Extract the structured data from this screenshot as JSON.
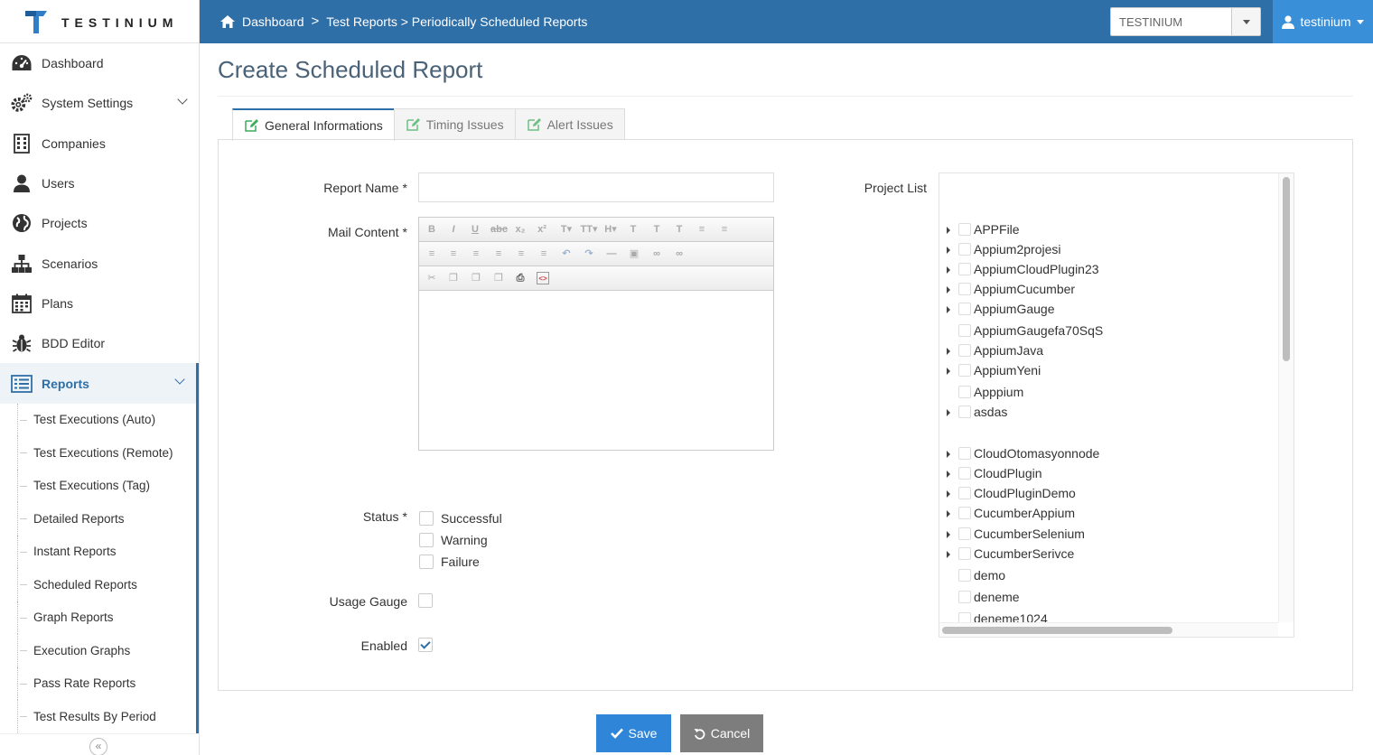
{
  "app": {
    "name": "TESTINIUM"
  },
  "breadcrumb": {
    "home": "Dashboard",
    "separator": ">",
    "path": "Test Reports > Periodically Scheduled Reports"
  },
  "company_select": {
    "value": "TESTINIUM"
  },
  "user": {
    "name": "testinium"
  },
  "sidebar": {
    "items": [
      {
        "label": "Dashboard",
        "icon": "dashboard-icon"
      },
      {
        "label": "System Settings",
        "icon": "gears-icon"
      },
      {
        "label": "Companies",
        "icon": "building-icon"
      },
      {
        "label": "Users",
        "icon": "user-icon"
      },
      {
        "label": "Projects",
        "icon": "globe-icon"
      },
      {
        "label": "Scenarios",
        "icon": "sitemap-icon"
      },
      {
        "label": "Plans",
        "icon": "calendar-icon"
      },
      {
        "label": "BDD Editor",
        "icon": "bug-icon"
      },
      {
        "label": "Reports",
        "icon": "list-icon"
      }
    ],
    "sub_items": [
      "Test Executions (Auto)",
      "Test Executions (Remote)",
      "Test Executions (Tag)",
      "Detailed Reports",
      "Instant Reports",
      "Scheduled Reports",
      "Graph Reports",
      "Execution Graphs",
      "Pass Rate Reports",
      "Test Results By Period"
    ],
    "collapse_glyph": "«"
  },
  "page": {
    "title": "Create Scheduled Report"
  },
  "tabs": [
    {
      "label": "General Informations",
      "active": true
    },
    {
      "label": "Timing Issues",
      "active": false
    },
    {
      "label": "Alert Issues",
      "active": false
    }
  ],
  "form": {
    "report_name_label": "Report Name",
    "mail_content_label": "Mail Content",
    "required_mark": "*",
    "status_label": "Status",
    "status_options": [
      {
        "label": "Successful",
        "checked": false
      },
      {
        "label": "Warning",
        "checked": false
      },
      {
        "label": "Failure",
        "checked": false
      }
    ],
    "usage_gauge_label": "Usage Gauge",
    "usage_gauge_checked": false,
    "enabled_label": "Enabled",
    "enabled_checked": true,
    "report_name_value": ""
  },
  "project_list": {
    "label": "Project List",
    "items": [
      {
        "name": "APPFile",
        "expandable": true
      },
      {
        "name": "Appium2projesi",
        "expandable": true
      },
      {
        "name": "AppiumCloudPlugin23",
        "expandable": true
      },
      {
        "name": "AppiumCucumber",
        "expandable": true
      },
      {
        "name": "AppiumGauge",
        "expandable": true
      },
      {
        "name": "AppiumGaugefa70SqS",
        "expandable": false
      },
      {
        "name": "AppiumJava",
        "expandable": true
      },
      {
        "name": "AppiumYeni",
        "expandable": true
      },
      {
        "name": "Apppium",
        "expandable": false
      },
      {
        "name": "asdas",
        "expandable": true
      },
      {
        "name": "CloudOtomasyonnode",
        "expandable": true
      },
      {
        "name": "CloudPlugin",
        "expandable": true
      },
      {
        "name": "CloudPluginDemo",
        "expandable": true
      },
      {
        "name": "CucumberAppium",
        "expandable": true
      },
      {
        "name": "CucumberSelenium",
        "expandable": true
      },
      {
        "name": "CucumberSerivce",
        "expandable": true
      },
      {
        "name": "demo",
        "expandable": false
      },
      {
        "name": "deneme",
        "expandable": false
      },
      {
        "name": "deneme1024",
        "expandable": false
      }
    ]
  },
  "buttons": {
    "save": "Save",
    "cancel": "Cancel"
  },
  "colors": {
    "primary": "#2f6fa8",
    "accent": "#3a8fd9",
    "save": "#2f86d9",
    "cancel": "#7d7d7d"
  }
}
